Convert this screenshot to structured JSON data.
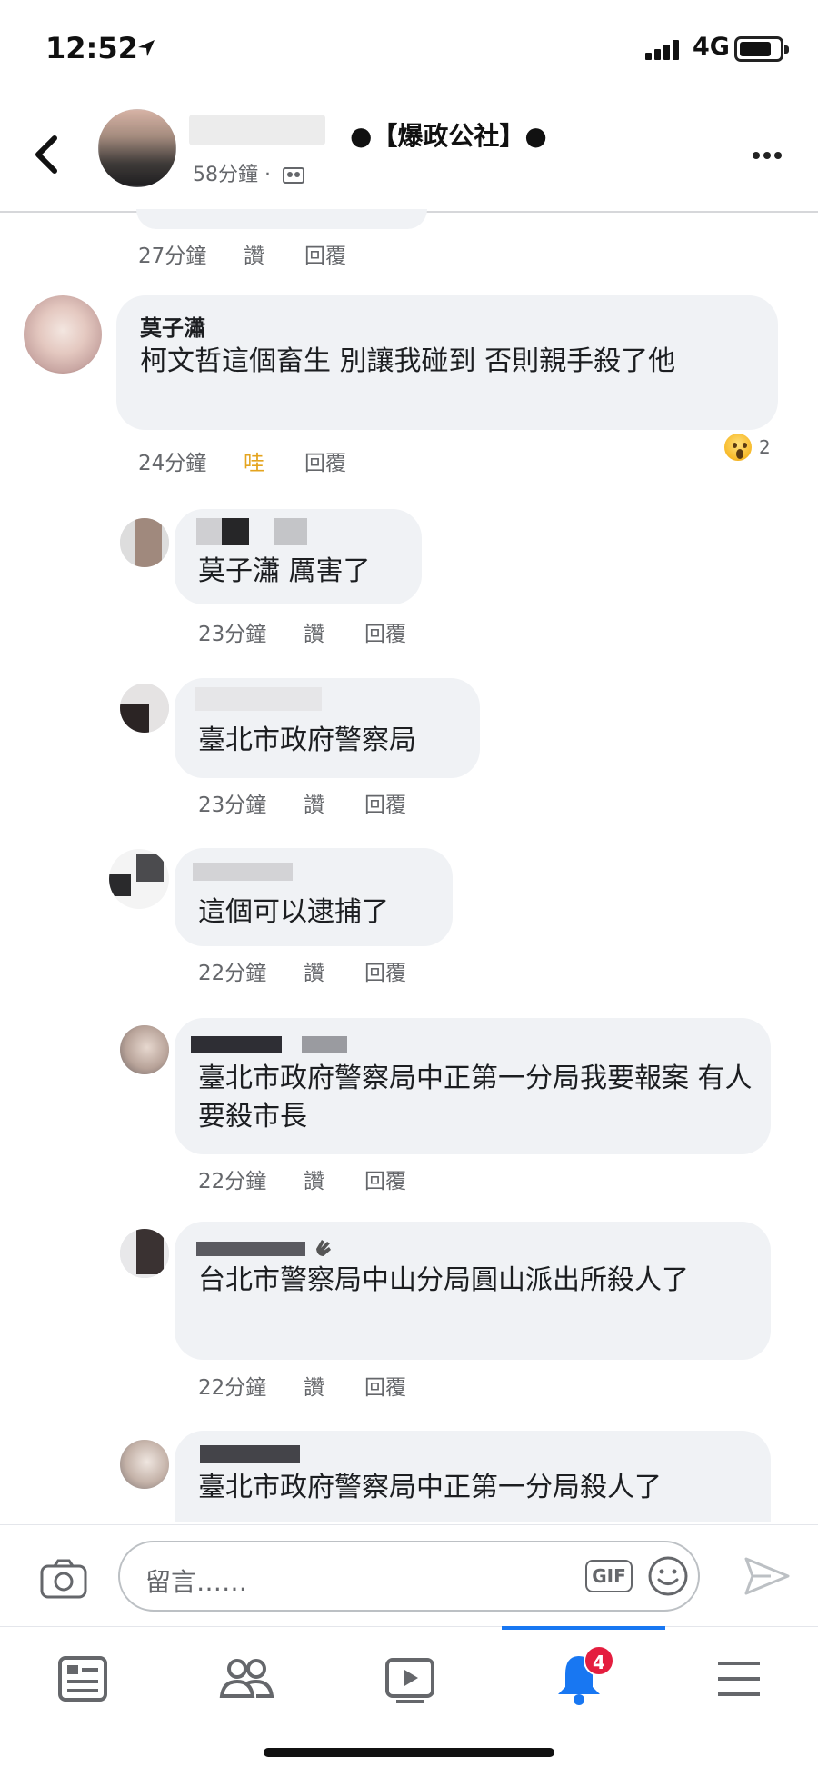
{
  "status_bar": {
    "time": "12:52",
    "network": "4G"
  },
  "header": {
    "group_title": "●【爆政公社】●",
    "meta": "58分鐘 ·"
  },
  "colors": {
    "accent": "#1877f2",
    "wow": "#e4a41f",
    "badge": "#e41e3f",
    "bubble": "#f0f2f5"
  },
  "action_labels": {
    "like": "讚",
    "reply": "回覆",
    "wow": "哇"
  },
  "comments": [
    {
      "time": "27分鐘"
    },
    {
      "name": "莫子瀟",
      "text": "柯文哲這個畜生  別讓我碰到  否則親手殺了他",
      "time": "24分鐘",
      "reaction": "wow",
      "reaction_count": "2"
    },
    {
      "text": "莫子瀟 厲害了",
      "time": "23分鐘"
    },
    {
      "text": "臺北市政府警察局",
      "time": "23分鐘"
    },
    {
      "text": "這個可以逮捕了",
      "time": "22分鐘"
    },
    {
      "text": "臺北市政府警察局中正第一分局我要報案 有人要殺市長",
      "time": "22分鐘"
    },
    {
      "text": "台北市警察局中山分局圓山派出所殺人了",
      "time": "22分鐘"
    },
    {
      "text": "臺北市政府警察局中正第一分局殺人了"
    }
  ],
  "comment_input": {
    "placeholder": "留言……",
    "gif_label": "GIF"
  },
  "nav": {
    "icons": [
      "news-feed-icon",
      "friends-icon",
      "watch-icon",
      "notifications-icon",
      "menu-icon"
    ],
    "notification_badge": "4"
  }
}
